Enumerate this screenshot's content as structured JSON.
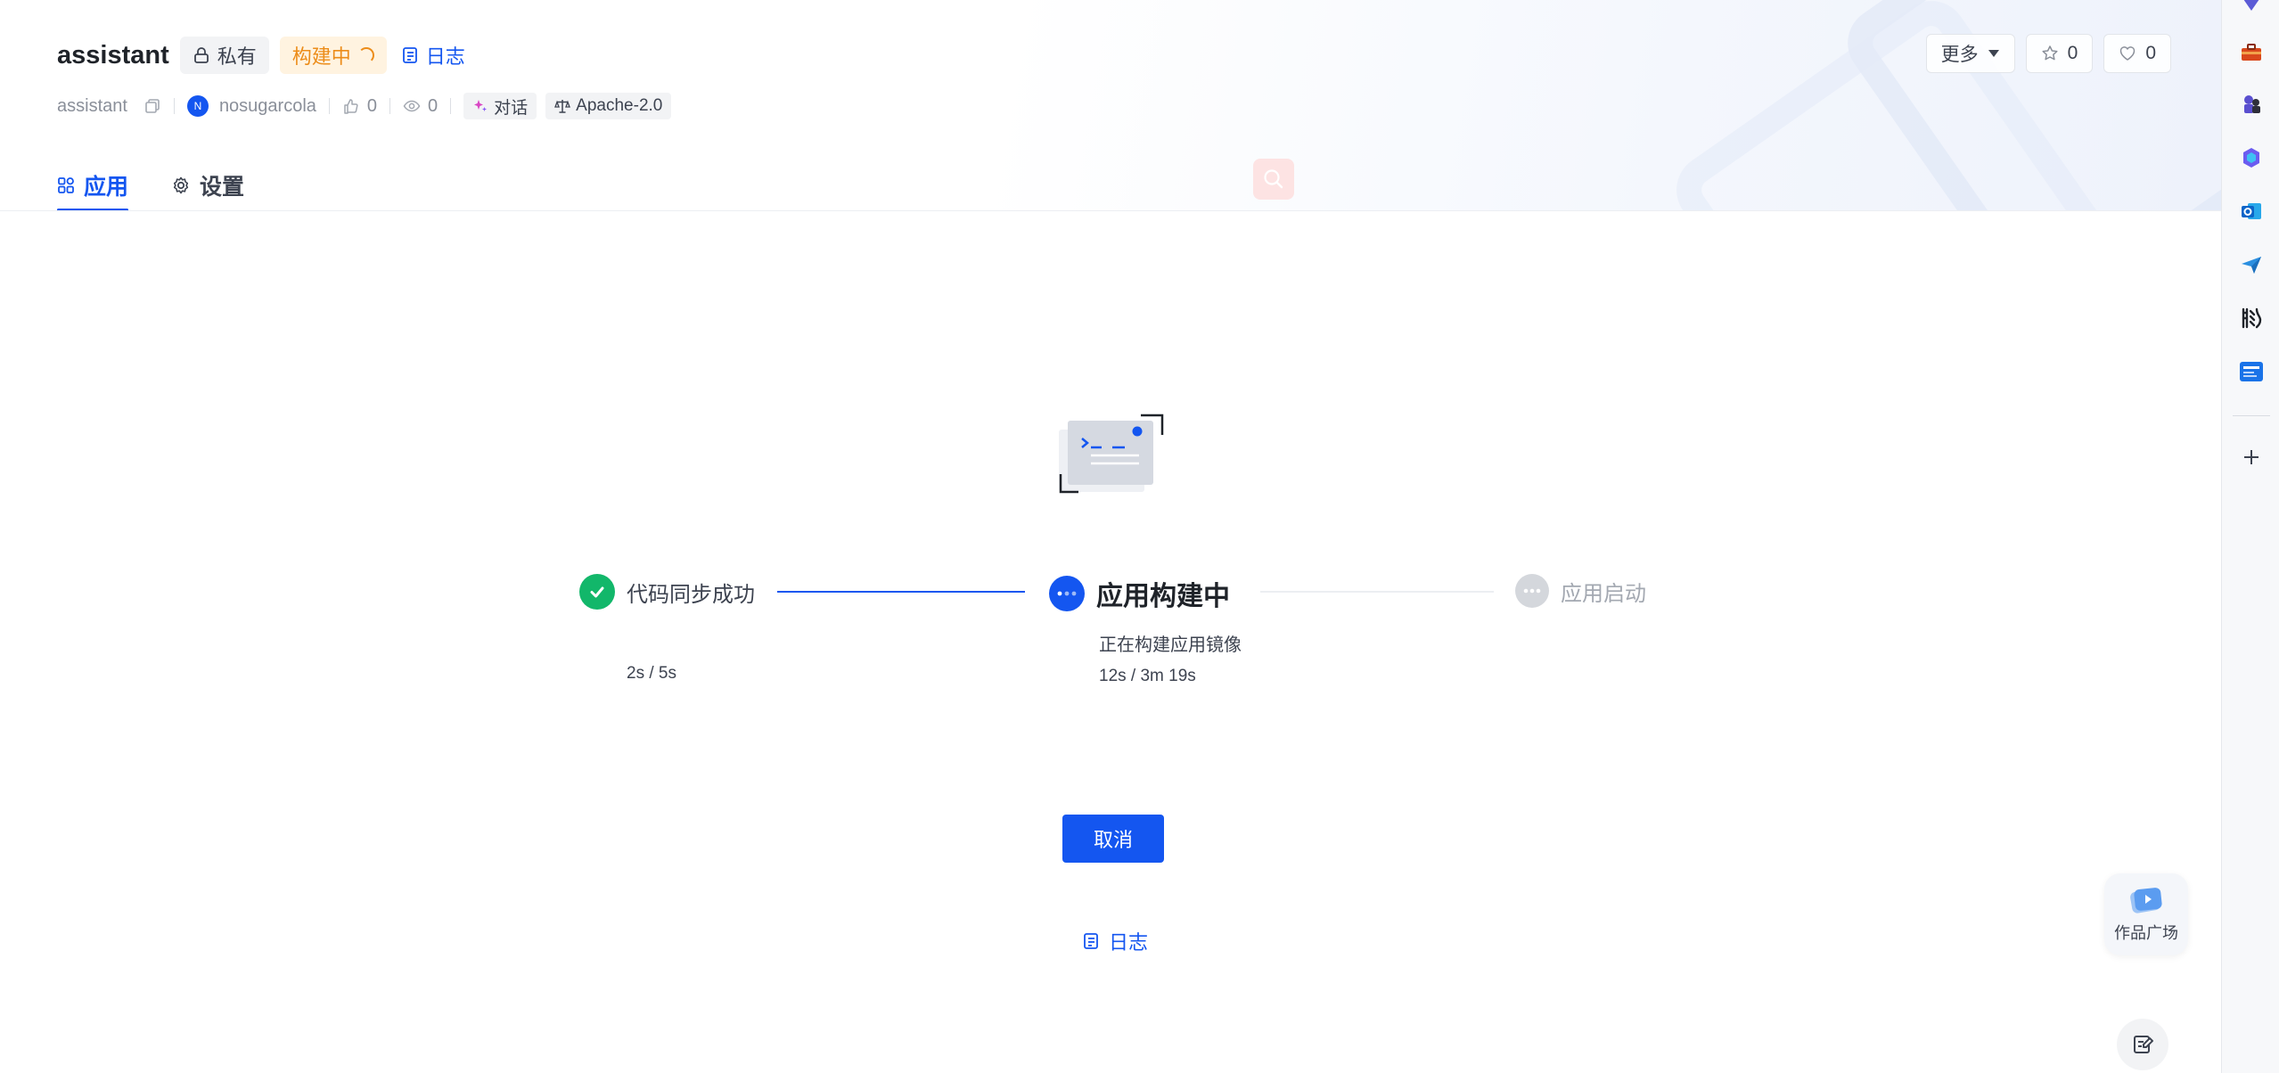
{
  "header": {
    "app_name": "assistant",
    "private_tag": "私有",
    "status_tag": "构建中",
    "log_link": "日志",
    "meta": {
      "repo": "assistant",
      "avatar_initial": "N",
      "owner": "nosugarcola",
      "likes": "0",
      "views": "0",
      "type_chip": "对话",
      "license_chip": "Apache-2.0"
    },
    "actions": {
      "more_label": "更多",
      "star_count": "0",
      "heart_count": "0"
    }
  },
  "tabs": [
    {
      "label": "应用",
      "icon": "grid-icon",
      "active": true
    },
    {
      "label": "设置",
      "icon": "gear-icon",
      "active": false
    }
  ],
  "steps": [
    {
      "title": "代码同步成功",
      "time": "2s / 5s",
      "state": "done",
      "color": "#12b76a"
    },
    {
      "title": "应用构建中",
      "subtitle": "正在构建应用镜像",
      "time": "12s / 3m 19s",
      "state": "active",
      "color": "#1456f0"
    },
    {
      "title": "应用启动",
      "state": "pending",
      "color": "#c9ccd2"
    }
  ],
  "cancel_button": "取消",
  "bottom_log_link": "日志",
  "gallery_label": "作品广场",
  "sidebar": {
    "icons": [
      "gem-icon",
      "toolbox-icon",
      "chess-icon",
      "copilot-icon",
      "outlook-icon",
      "paper-plane-icon",
      "pengpai-icon",
      "app-store-icon"
    ],
    "add_icon": "plus-icon"
  },
  "colors": {
    "primary": "#1456f0",
    "success": "#12b76a",
    "warning": "#ec8c19",
    "muted": "#c9ccd2"
  }
}
